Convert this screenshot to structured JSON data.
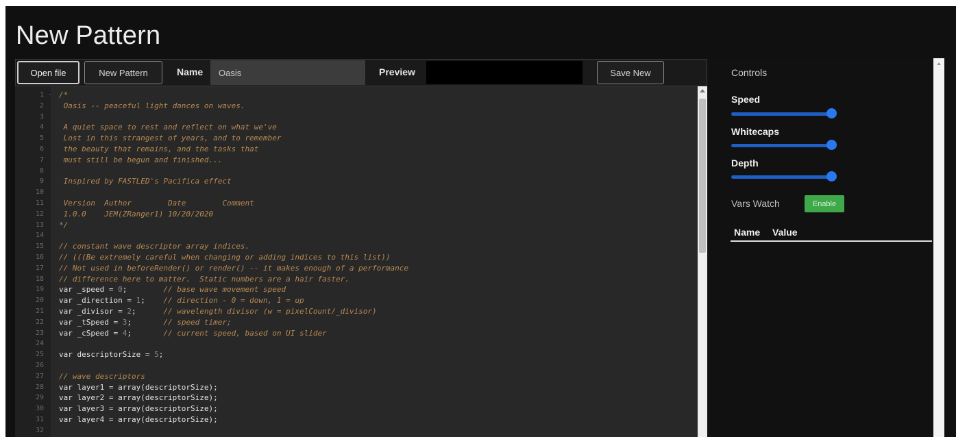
{
  "page": {
    "title": "New Pattern"
  },
  "toolbar": {
    "open_file_label": "Open file",
    "new_pattern_label": "New Pattern",
    "name_label": "Name",
    "name_value": "Oasis",
    "preview_label": "Preview",
    "save_new_label": "Save New"
  },
  "editor": {
    "language": "javascript",
    "lines": [
      {
        "n": "1",
        "fold": "-",
        "type": "comment",
        "text": "/*"
      },
      {
        "n": "2",
        "type": "comment",
        "text": " Oasis -- peaceful light dances on waves."
      },
      {
        "n": "3",
        "type": "comment",
        "text": ""
      },
      {
        "n": "4",
        "type": "comment",
        "text": " A quiet space to rest and reflect on what we've"
      },
      {
        "n": "5",
        "type": "comment",
        "text": " Lost in this strangest of years, and to remember"
      },
      {
        "n": "6",
        "type": "comment",
        "text": " the beauty that remains, and the tasks that"
      },
      {
        "n": "7",
        "type": "comment",
        "text": " must still be begun and finished..."
      },
      {
        "n": "8",
        "type": "comment",
        "text": ""
      },
      {
        "n": "9",
        "type": "comment",
        "text": " Inspired by FASTLED's Pacifica effect"
      },
      {
        "n": "10",
        "type": "comment",
        "text": ""
      },
      {
        "n": "11",
        "type": "comment",
        "text": " Version  Author        Date        Comment"
      },
      {
        "n": "12",
        "type": "comment",
        "text": " 1.0.0    JEM(ZRanger1) 10/20/2020"
      },
      {
        "n": "13",
        "type": "comment",
        "text": "*/"
      },
      {
        "n": "14",
        "type": "blank",
        "text": ""
      },
      {
        "n": "15",
        "type": "comment",
        "text": "// constant wave descriptor array indices."
      },
      {
        "n": "16",
        "type": "comment",
        "text": "// (((Be extremely careful when changing or adding indices to this list))"
      },
      {
        "n": "17",
        "type": "comment",
        "text": "// Not used in beforeRender() or render() -- it makes enough of a performance"
      },
      {
        "n": "18",
        "type": "comment",
        "text": "// difference here to matter.  Static numbers are a hair faster."
      },
      {
        "n": "19",
        "type": "var",
        "code": "var _speed = ",
        "num": "0",
        "semi": ";",
        "pad": "        ",
        "comment": "// base wave movement speed"
      },
      {
        "n": "20",
        "type": "var",
        "code": "var _direction = ",
        "num": "1",
        "semi": ";",
        "pad": "    ",
        "comment": "// direction - 0 = down, 1 = up"
      },
      {
        "n": "21",
        "type": "var",
        "code": "var _divisor = ",
        "num": "2",
        "semi": ";",
        "pad": "      ",
        "comment": "// wavelength divisor (w = pixelCount/_divisor)"
      },
      {
        "n": "22",
        "type": "var",
        "code": "var _tSpeed = ",
        "num": "3",
        "semi": ";",
        "pad": "       ",
        "comment": "// speed timer;"
      },
      {
        "n": "23",
        "type": "var",
        "code": "var _cSpeed = ",
        "num": "4",
        "semi": ";",
        "pad": "       ",
        "comment": "// current speed, based on UI slider"
      },
      {
        "n": "24",
        "type": "blank",
        "text": ""
      },
      {
        "n": "25",
        "type": "var",
        "code": "var descriptorSize = ",
        "num": "5",
        "semi": ";",
        "pad": "",
        "comment": ""
      },
      {
        "n": "26",
        "type": "blank",
        "text": ""
      },
      {
        "n": "27",
        "type": "comment",
        "text": "// wave descriptors"
      },
      {
        "n": "28",
        "type": "code",
        "text": "var layer1 = array(descriptorSize);"
      },
      {
        "n": "29",
        "type": "code",
        "text": "var layer2 = array(descriptorSize);"
      },
      {
        "n": "30",
        "type": "code",
        "text": "var layer3 = array(descriptorSize);"
      },
      {
        "n": "31",
        "type": "code",
        "text": "var layer4 = array(descriptorSize);"
      },
      {
        "n": "32",
        "type": "blank",
        "text": ""
      }
    ]
  },
  "controls": {
    "heading": "Controls",
    "sliders": [
      {
        "label": "Speed",
        "value": 1.0
      },
      {
        "label": "Whitecaps",
        "value": 1.0
      },
      {
        "label": "Depth",
        "value": 1.0
      }
    ],
    "vars_watch_label": "Vars Watch",
    "enable_label": "Enable",
    "table_headers": {
      "name": "Name",
      "value": "Value"
    }
  },
  "colors": {
    "background": "#101010",
    "editor_bg": "#282828",
    "comment": "#b88a52",
    "slider": "#2a78f0",
    "enable_button": "#3fa94a"
  }
}
